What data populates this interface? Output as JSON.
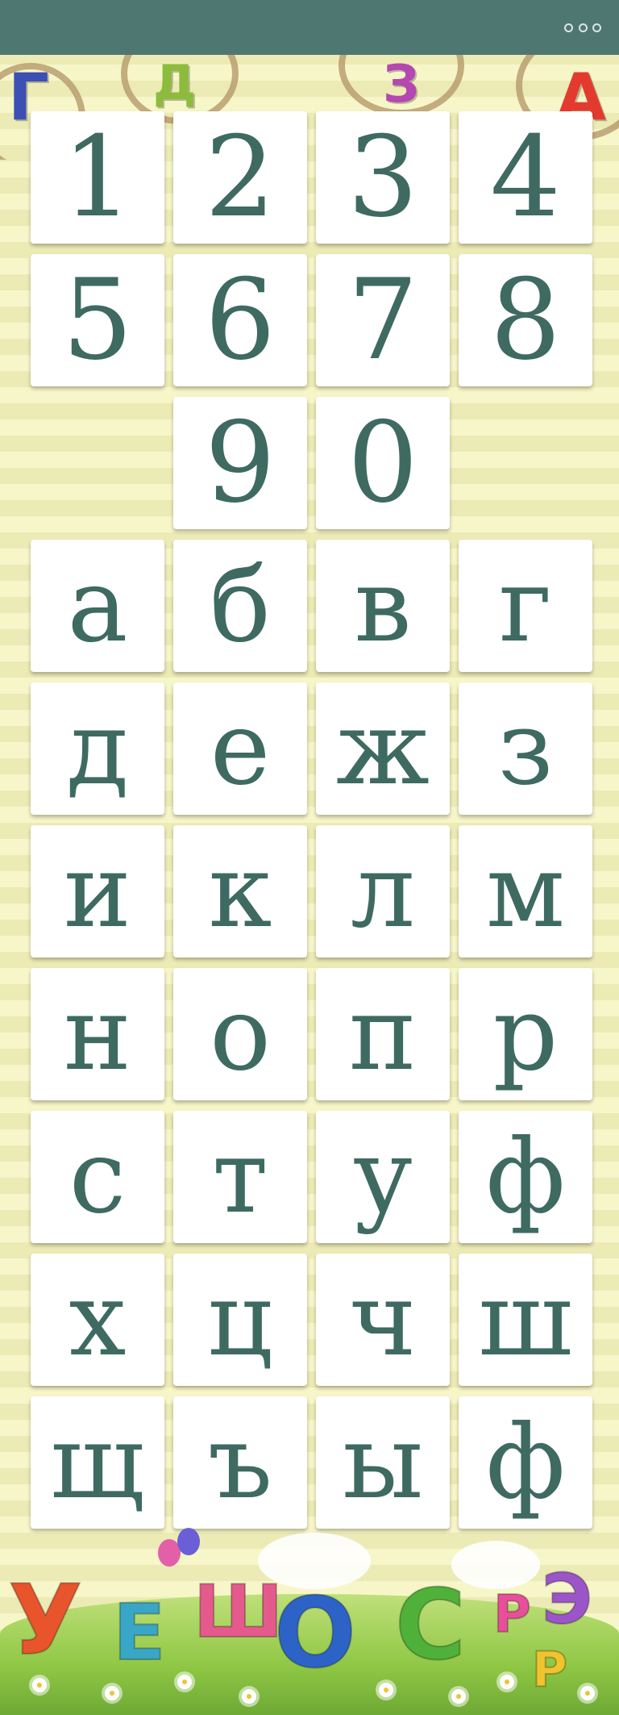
{
  "header": {
    "menu_icon": "more-dots-icon"
  },
  "decor_top": [
    "Г",
    "Д",
    "З",
    "А"
  ],
  "tiles": [
    "1",
    "2",
    "3",
    "4",
    "5",
    "6",
    "7",
    "8",
    "9",
    "0",
    "а",
    "б",
    "в",
    "г",
    "д",
    "е",
    "ж",
    "з",
    "и",
    "к",
    "л",
    "м",
    "н",
    "о",
    "п",
    "р",
    "с",
    "т",
    "у",
    "ф",
    "х",
    "ц",
    "ч",
    "ш",
    "щ",
    "ъ",
    "ы",
    "ф"
  ],
  "decor_bottom": [
    "У",
    "Е",
    "Ш",
    "О",
    "С",
    "Р",
    "Э",
    "Р"
  ],
  "colors": {
    "header": "#4f7771",
    "tile_text": "#3e6a62",
    "tile_bg": "#ffffff"
  }
}
